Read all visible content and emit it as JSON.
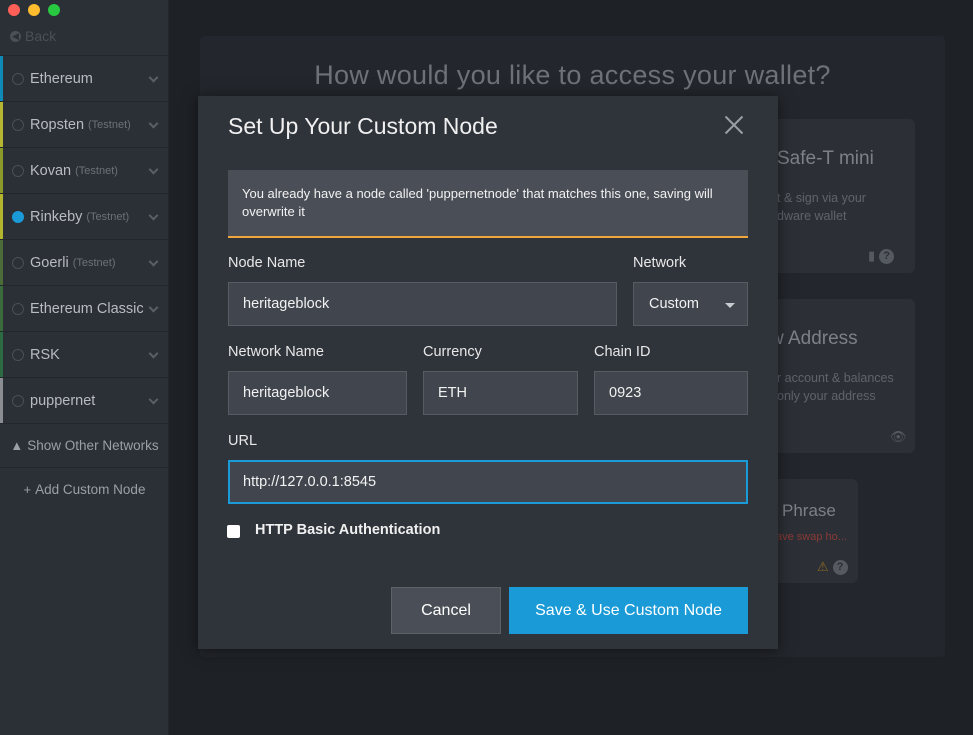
{
  "window": {
    "back_label": "Back"
  },
  "sidebar": {
    "networks": [
      {
        "name": "Ethereum",
        "tag": "",
        "color": "#0f8ab8",
        "selected": false
      },
      {
        "name": "Ropsten",
        "tag": "(Testnet)",
        "color": "#b5b531",
        "selected": false
      },
      {
        "name": "Kovan",
        "tag": "(Testnet)",
        "color": "#8c9a2a",
        "selected": false
      },
      {
        "name": "Rinkeby",
        "tag": "(Testnet)",
        "color": "#b4b52f",
        "selected": true
      },
      {
        "name": "Goerli",
        "tag": "(Testnet)",
        "color": "#4b6b39",
        "selected": false
      },
      {
        "name": "Ethereum Classic",
        "tag": "",
        "color": "#3b6b3d",
        "selected": false
      },
      {
        "name": "RSK",
        "tag": "",
        "color": "#2c6a41",
        "selected": false
      },
      {
        "name": "puppernet",
        "tag": "",
        "color": "#8a8d91",
        "selected": false
      }
    ],
    "show_other_networks": "Show Other Networks",
    "add_custom_node": "Add Custom Node"
  },
  "background": {
    "title": "How would you like to access your wallet?",
    "card_safet": {
      "title": "Safe-T mini",
      "line1": "t & sign via your",
      "line2": "dware wallet"
    },
    "card_address": {
      "title": "w Address",
      "line1": "r account & balances",
      "line2": "only your address"
    },
    "card_phrase": {
      "title": "Phrase",
      "warning": "ave swap ho..."
    }
  },
  "modal": {
    "title": "Set Up Your Custom Node",
    "alert": "You already have a node called 'puppernetnode' that matches this one, saving will overwrite it",
    "node_name_label": "Node Name",
    "node_name_value": "heritageblock",
    "network_label": "Network",
    "network_value": "Custom",
    "network_name_label": "Network Name",
    "network_name_value": "heritageblock",
    "currency_label": "Currency",
    "currency_value": "ETH",
    "chain_id_label": "Chain ID",
    "chain_id_value": "0923",
    "url_label": "URL",
    "url_value": "http://127.0.0.1:8545",
    "http_auth_label": "HTTP Basic Authentication",
    "http_auth_checked": false,
    "cancel_label": "Cancel",
    "save_label": "Save & Use Custom Node"
  },
  "colors": {
    "accent": "#1a9ad6",
    "warning_border": "#f0a63a"
  }
}
